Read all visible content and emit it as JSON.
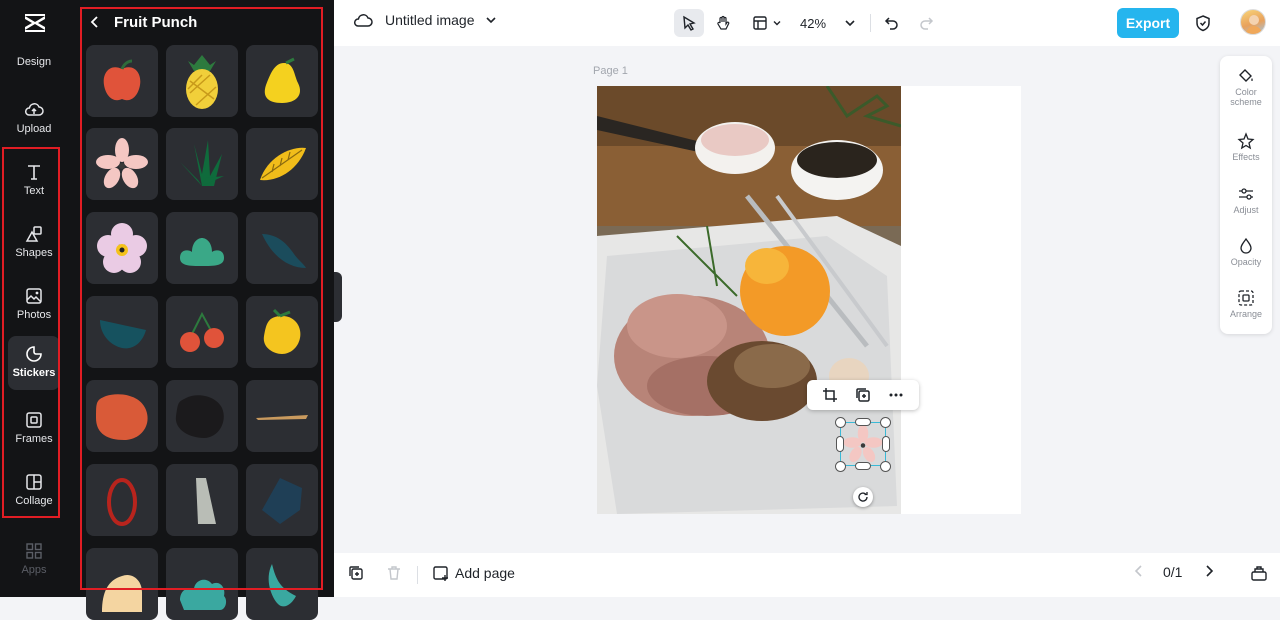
{
  "rail": {
    "items": [
      {
        "label": "Design"
      },
      {
        "label": "Upload"
      },
      {
        "label": "Text"
      },
      {
        "label": "Shapes"
      },
      {
        "label": "Photos"
      },
      {
        "label": "Stickers"
      },
      {
        "label": "Frames"
      },
      {
        "label": "Collage"
      },
      {
        "label": "Apps"
      }
    ],
    "active": "Stickers"
  },
  "panel": {
    "title": "Fruit Punch",
    "stickers": [
      "red apple",
      "pineapple",
      "yellow pear",
      "pink flower",
      "green leaves",
      "yellow leaf",
      "lilac flower",
      "green bush",
      "teal leaf",
      "teal bowl",
      "red cherries",
      "yellow lemon",
      "red blob",
      "dark blob",
      "tan stroke",
      "red ring",
      "grey stone",
      "dark blue shape",
      "peach shape",
      "teal cloud",
      "teal leaf curl"
    ]
  },
  "topbar": {
    "doc_title": "Untitled image",
    "zoom": "42%",
    "export_label": "Export"
  },
  "canvas": {
    "page_label": "Page 1"
  },
  "right_panel": {
    "items": [
      "Color scheme",
      "Effects",
      "Adjust",
      "Opacity",
      "Arrange"
    ]
  },
  "bottombar": {
    "add_page_label": "Add page",
    "pagination": "0/1"
  },
  "colors": {
    "accent": "#25b5ee",
    "highlight_box": "#e11d24",
    "sidebar_bg": "#131416"
  }
}
